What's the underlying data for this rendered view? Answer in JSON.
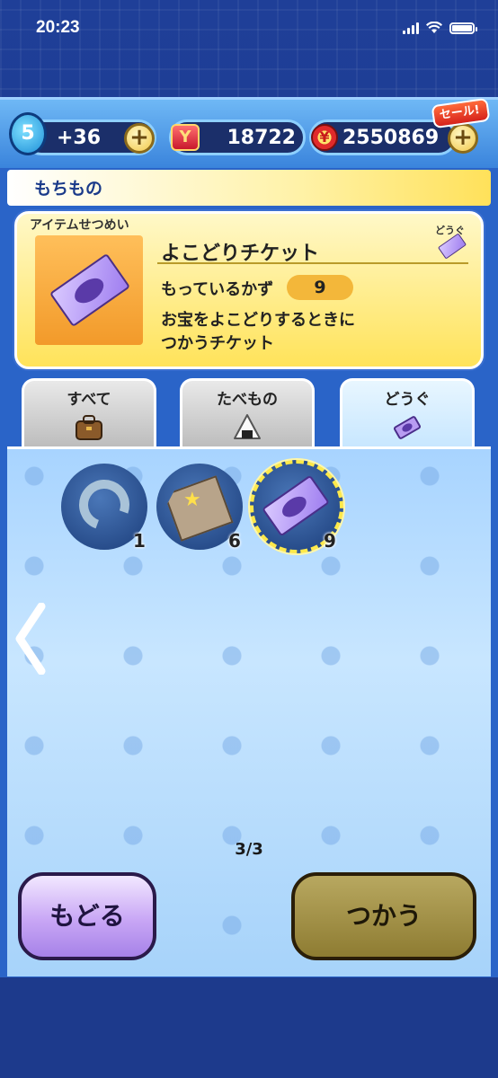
{
  "status_bar": {
    "time": "20:23"
  },
  "currency": {
    "spirit_level": "5",
    "spirit_bonus": "+36",
    "y_coins": "18722",
    "money": "2550869",
    "sale_label": "セール!"
  },
  "section": {
    "title": "もちもの"
  },
  "description": {
    "label": "アイテムせつめい",
    "name": "よこどりチケット",
    "count_label": "もっているかず",
    "count": "9",
    "text_line1": "お宝をよこどりするときに",
    "text_line2": "つかうチケット",
    "category": "どうぐ"
  },
  "tabs": [
    {
      "label": "すべて",
      "icon": "bag-icon"
    },
    {
      "label": "たべもの",
      "icon": "onigiri-icon"
    },
    {
      "label": "どうぐ",
      "icon": "ticket-icon",
      "active": true
    }
  ],
  "items": [
    {
      "icon": "horseshoe-icon",
      "count": "1"
    },
    {
      "icon": "wooden-tag-icon",
      "count": "6"
    },
    {
      "icon": "ticket-icon",
      "count": "9",
      "selected": true
    }
  ],
  "pager": {
    "text": "3/3"
  },
  "buttons": {
    "back": "もどる",
    "use": "つかう"
  },
  "colors": {
    "panel": "#2a64c8",
    "highlight": "#ffe94a",
    "back_button": "#c8a6f5",
    "use_button": "#8e7c32"
  }
}
